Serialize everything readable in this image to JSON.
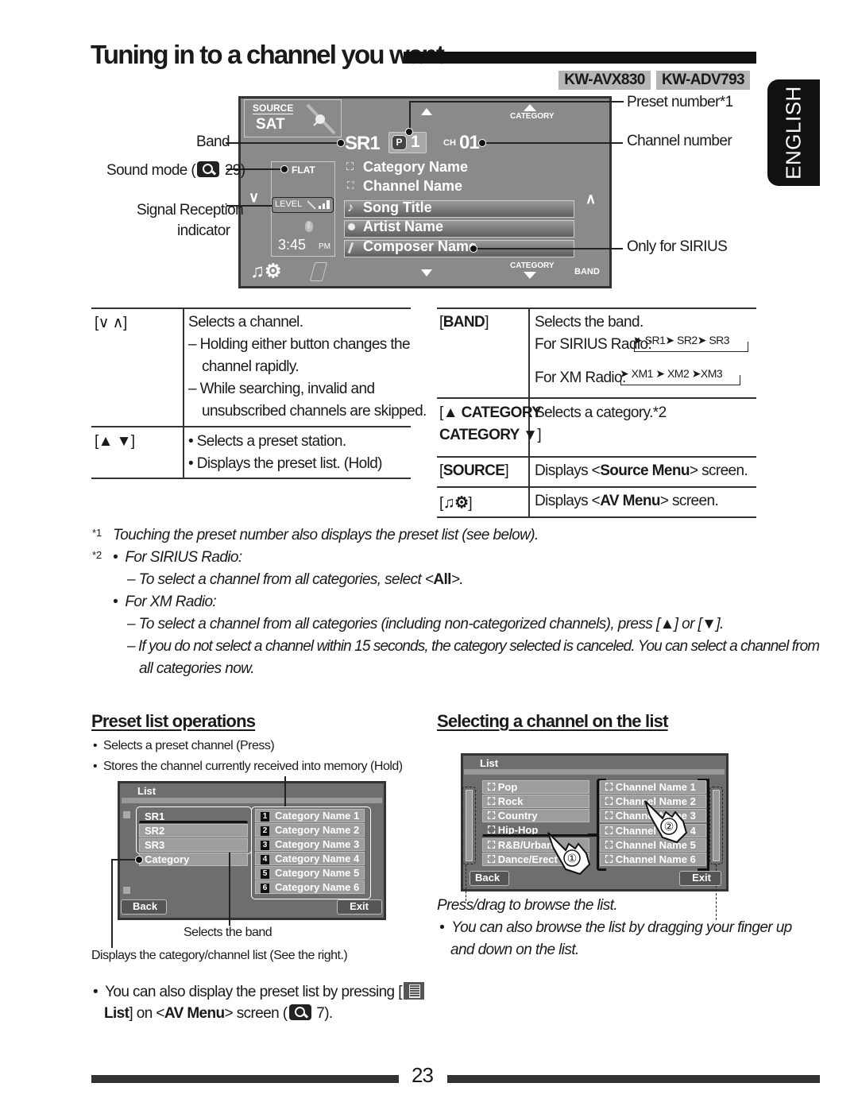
{
  "header": {
    "title": "Tuning in to a channel you want",
    "models": [
      "KW-AVX830",
      "KW-ADV793"
    ],
    "language_tab": "ENGLISH"
  },
  "device_screen": {
    "source_label": "SOURCE",
    "source_value": "SAT",
    "band": "SR1",
    "preset_prefix": "P",
    "preset_number": "1",
    "channel_prefix": "CH",
    "channel_number": "01",
    "sound_mode": "FLAT",
    "level_label": "LEVEL",
    "clock_time": "3:45",
    "clock_ampm": "PM",
    "category_name": "Category Name",
    "channel_name": "Channel Name",
    "song_title": "Song Title",
    "artist_name": "Artist Name",
    "composer_name": "Composer Name",
    "category_up_label": "CATEGORY",
    "category_down_label": "CATEGORY",
    "band_button": "BAND"
  },
  "callouts": {
    "band": "Band",
    "sound_mode": "Sound mode (",
    "sound_mode_ref": "29)",
    "signal_reception_1": "Signal Reception",
    "signal_reception_2": "indicator",
    "preset_number": "Preset number*1",
    "channel_number": "Channel number",
    "only_for_sirius": "Only for SIRIUS"
  },
  "left_table": [
    {
      "key": "[∨ ∧]",
      "lines": [
        "Selects a channel.",
        "– Holding either button changes the",
        "channel rapidly.",
        "– While searching, invalid and",
        "unsubscribed channels are skipped."
      ]
    },
    {
      "key": "[▲ ▼]",
      "lines": [
        "• Selects a preset station.",
        "• Displays the preset list. (Hold)"
      ]
    }
  ],
  "right_table": {
    "band_key": "BAND",
    "band_desc": "Selects the band.",
    "sirius_label": "For SIRIUS Radio:",
    "sirius_bands": [
      "SR1",
      "SR2",
      "SR3"
    ],
    "xm_label": "For XM Radio:",
    "xm_bands": [
      "XM1",
      "XM2",
      "XM3"
    ],
    "category_key_1": "▲ CATEGORY",
    "category_key_2": "CATEGORY ▼",
    "category_desc": "Selects a category.*2",
    "source_key": "SOURCE",
    "source_desc_pre": "Displays <",
    "source_desc_bold": "Source Menu",
    "source_desc_post": "> screen.",
    "avmenu_desc_pre": "Displays <",
    "avmenu_desc_bold": "AV Menu",
    "avmenu_desc_post": "> screen."
  },
  "footnotes": {
    "n1_mark": "*1",
    "n1_text": "Touching the preset number also displays the preset list (see below).",
    "n2_mark": "*2",
    "sirius_head": "For SIRIUS Radio:",
    "sirius_line_pre": "– To select a channel from all categories, select <",
    "sirius_line_bold": "All",
    "sirius_line_post": ">.",
    "xm_head": "For XM Radio:",
    "xm_line1": "– To select a channel from all categories (including non-categorized channels), press [▲] or [▼].",
    "xm_line2a": "– If you do not select a channel within 15 seconds, the category selected is canceled. You can select a channel from",
    "xm_line2b": "all categories now."
  },
  "preset_section": {
    "heading": "Preset list operations",
    "bullets": [
      "Selects a preset channel (Press)",
      "Stores the channel currently received into memory (Hold)"
    ],
    "screen": {
      "title": "List",
      "bands": [
        "SR1",
        "SR2",
        "SR3"
      ],
      "category_button": "Category",
      "presets": [
        "Category Name 1",
        "Category Name 2",
        "Category Name 3",
        "Category Name 4",
        "Category Name 5",
        "Category Name 6"
      ],
      "back": "Back",
      "exit": "Exit"
    },
    "caption_band": "Selects the band",
    "caption_category": "Displays the category/channel list (See the right.)",
    "note_pre": "You can also display the preset list by pressing [",
    "note_bold": "List",
    "note_mid": "] on <",
    "note_bold2": "AV Menu",
    "note_post": "> screen (",
    "note_ref": "7)."
  },
  "selecting_section": {
    "heading": "Selecting a channel on the list",
    "screen": {
      "title": "List",
      "categories": [
        "Pop",
        "Rock",
        "Country",
        "Hip-Hop",
        "R&B/Urban",
        "Dance/Erect"
      ],
      "channels": [
        "Channel Name 1",
        "Channel Name 2",
        "Channel Name 3",
        "Channel Name 4",
        "Channel Name 5",
        "Channel Name 6"
      ],
      "back": "Back",
      "exit": "Exit",
      "step1": "①",
      "step2": "②"
    },
    "caption": "Press/drag to browse the list.",
    "bullet": "You can also browse the list by dragging your finger up",
    "bullet_cont": "and down on the list."
  },
  "page_number": "23"
}
